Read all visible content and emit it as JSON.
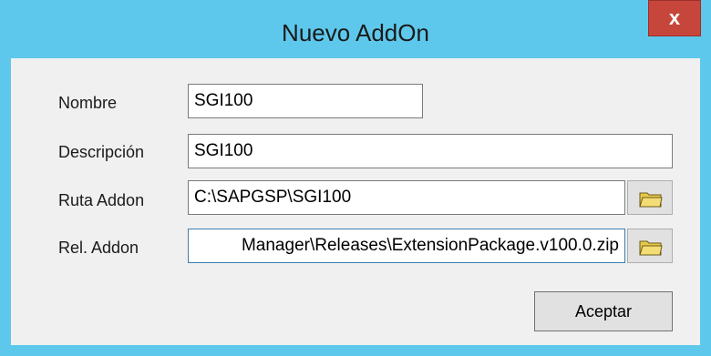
{
  "window": {
    "title": "Nuevo AddOn",
    "close_label": "x"
  },
  "form": {
    "nombre": {
      "label": "Nombre",
      "value": "SGI100"
    },
    "descripcion": {
      "label": "Descripción",
      "value": "SGI100"
    },
    "ruta_addon": {
      "label": "Ruta Addon",
      "value": "C:\\SAPGSP\\SGI100",
      "browse_icon": "folder-icon"
    },
    "rel_addon": {
      "label": "Rel. Addon",
      "value": "Manager\\Releases\\ExtensionPackage.v100.0.zip",
      "browse_icon": "folder-icon"
    }
  },
  "buttons": {
    "accept_label": "Aceptar"
  },
  "colors": {
    "title_bar": "#5ec8ec",
    "close_button": "#c7463c",
    "client_bg": "#f0f0f0"
  }
}
